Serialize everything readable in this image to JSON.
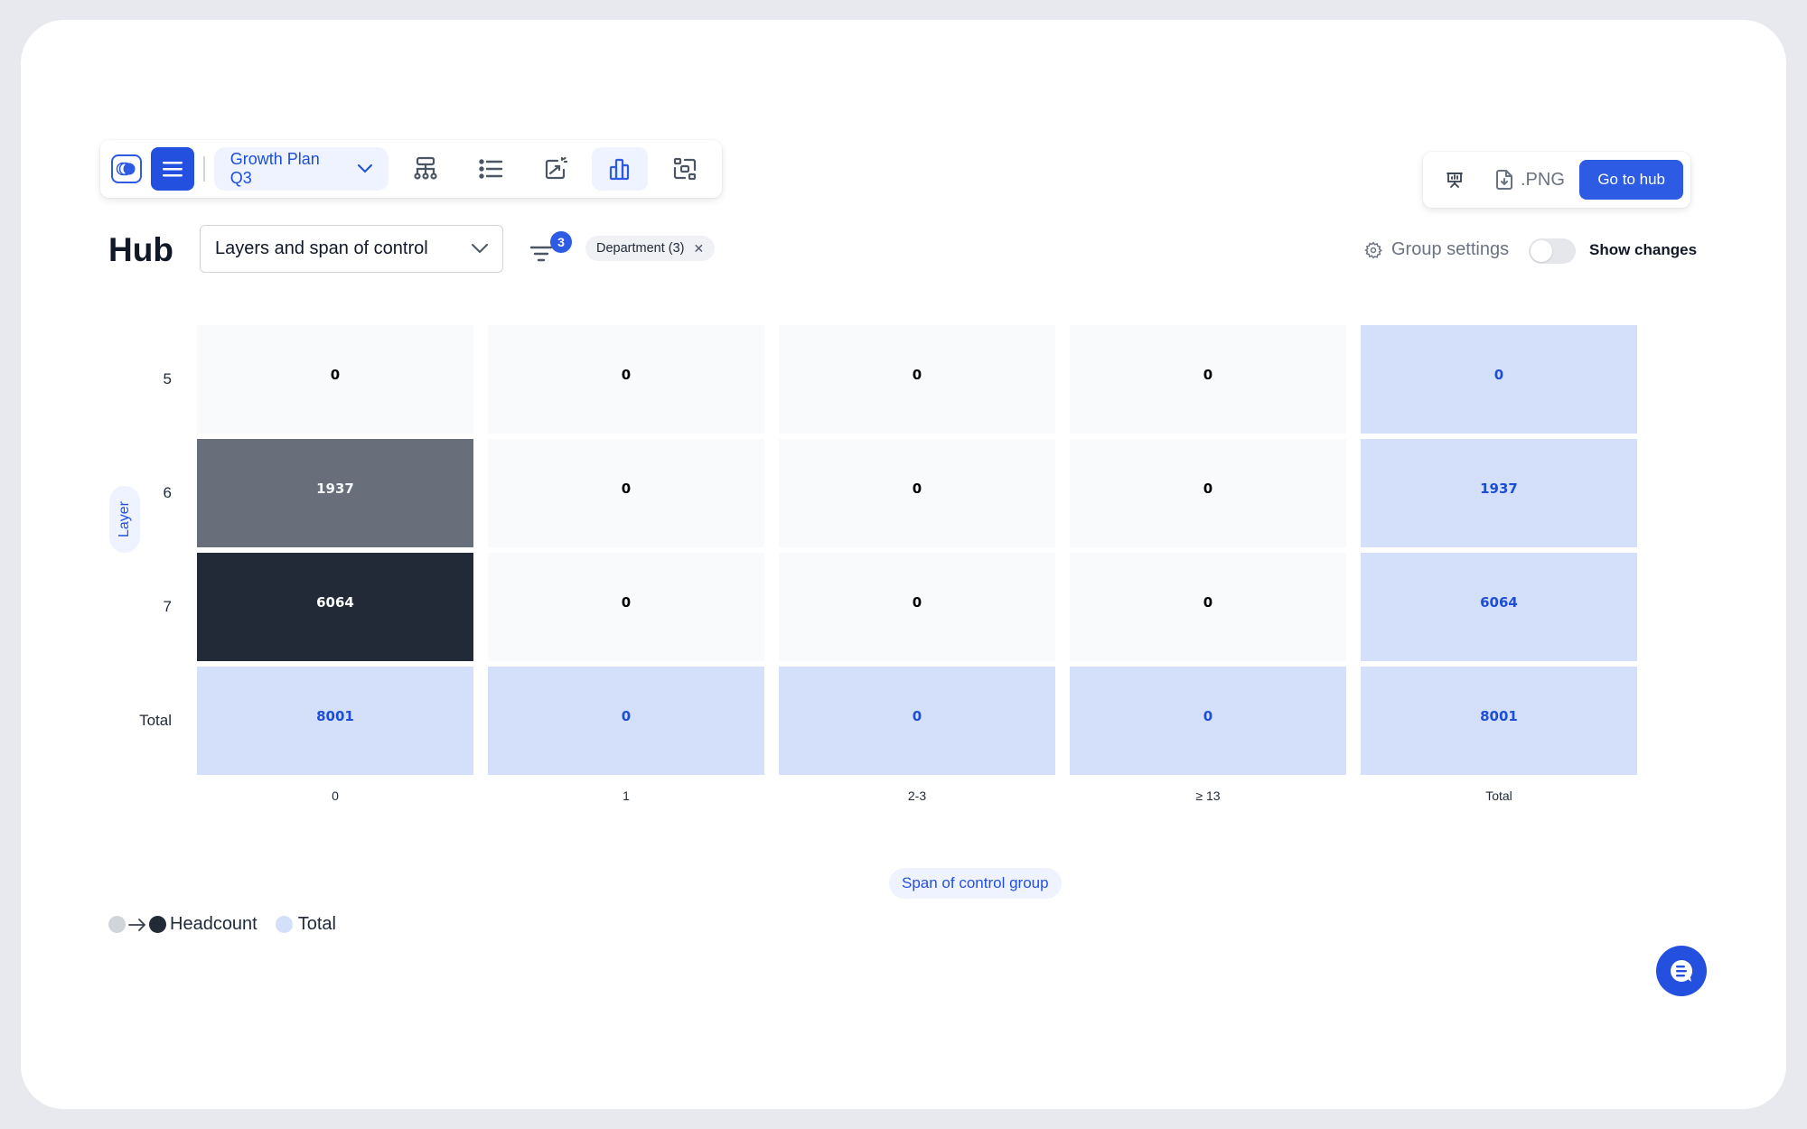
{
  "toolbar": {
    "plan_label": "Growth Plan Q3",
    "icons": [
      "logo-icon",
      "menu-icon",
      "org-chart-icon",
      "list-icon",
      "scenario-icon",
      "chart-icon",
      "compare-icon"
    ],
    "active_view": "chart-icon"
  },
  "right_toolbar": {
    "present_icon": "presentation-icon",
    "png_label": ".PNG",
    "go_to_hub_label": "Go to hub"
  },
  "header": {
    "title": "Hub",
    "view_select": {
      "selected": "Layers and span of control"
    },
    "filter_count": "3",
    "filter_chip": "Department (3)",
    "group_settings_label": "Group settings",
    "show_changes_label": "Show changes",
    "show_changes_on": false
  },
  "colors": {
    "accent": "#2d5be3",
    "cell_empty": "#f9fafb",
    "cell_mid": "#9499a3",
    "cell_high": "#222a38",
    "cell_total": "#d4dffa",
    "total_text": "#1d4ed8"
  },
  "chart_data": {
    "type": "heatmap",
    "title": "Layers and span of control",
    "xlabel": "Span of control group",
    "ylabel": "Layer",
    "rows": [
      "5",
      "6",
      "7",
      "Total"
    ],
    "columns": [
      "0",
      "1",
      "2-3",
      "≥ 13",
      "Total"
    ],
    "values": [
      [
        0,
        0,
        0,
        0,
        0
      ],
      [
        1937,
        0,
        0,
        0,
        1937
      ],
      [
        6064,
        0,
        0,
        0,
        6064
      ],
      [
        8001,
        0,
        0,
        0,
        8001
      ]
    ],
    "legend": [
      {
        "label": "Headcount",
        "kind": "gradient",
        "from": "#d1d5db",
        "to": "#222a38"
      },
      {
        "label": "Total",
        "kind": "swatch",
        "color": "#d4dffa"
      }
    ],
    "legend_position": "bottom-left"
  }
}
